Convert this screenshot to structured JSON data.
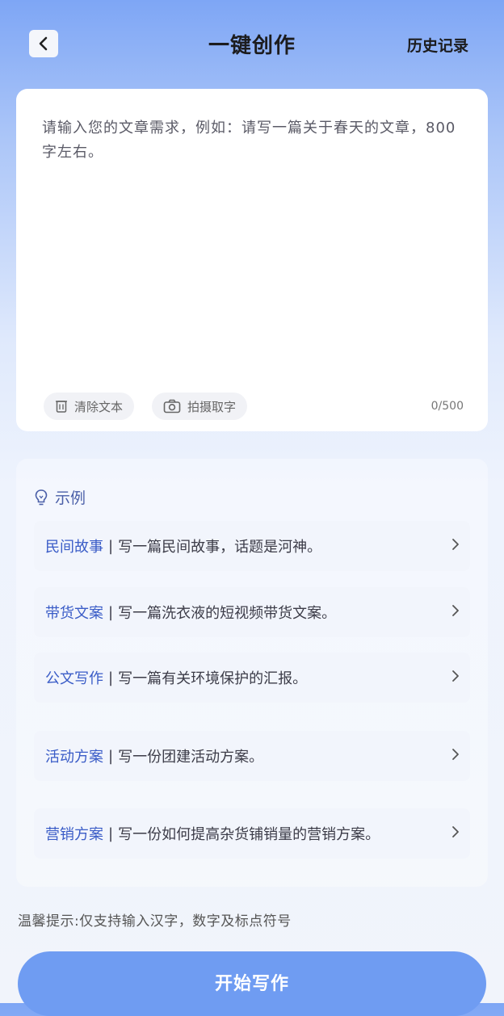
{
  "header": {
    "title": "一键创作",
    "history_label": "历史记录"
  },
  "editor": {
    "placeholder": "请输入您的文章需求，例如：请写一篇关于春天的文章，800字左右。",
    "clear_label": "清除文本",
    "photo_label": "拍摄取字",
    "counter": "0/500"
  },
  "examples": {
    "title": "示例",
    "items": [
      {
        "tag": "民间故事",
        "sep": "|",
        "text": "写一篇民间故事，话题是河神。"
      },
      {
        "tag": "带货文案",
        "sep": "|",
        "text": "写一篇洗衣液的短视频带货文案。"
      },
      {
        "tag": "公文写作",
        "sep": "|",
        "text": "写一篇有关环境保护的汇报。"
      },
      {
        "tag": "活动方案",
        "sep": "|",
        "text": "写一份团建活动方案。"
      },
      {
        "tag": "营销方案",
        "sep": "|",
        "text": "写一份如何提高杂货铺销量的营销方案。"
      }
    ]
  },
  "tip": "温馨提示:仅支持输入汉字，数字及标点符号",
  "start_label": "开始写作",
  "icons": {
    "back": "chevron-left-icon",
    "clear": "trash-icon",
    "photo": "camera-icon",
    "examples": "lightbulb-icon",
    "item": "chevron-right-icon"
  },
  "colors": {
    "accent": "#6f9cf2",
    "tag": "#3a5cc7"
  }
}
